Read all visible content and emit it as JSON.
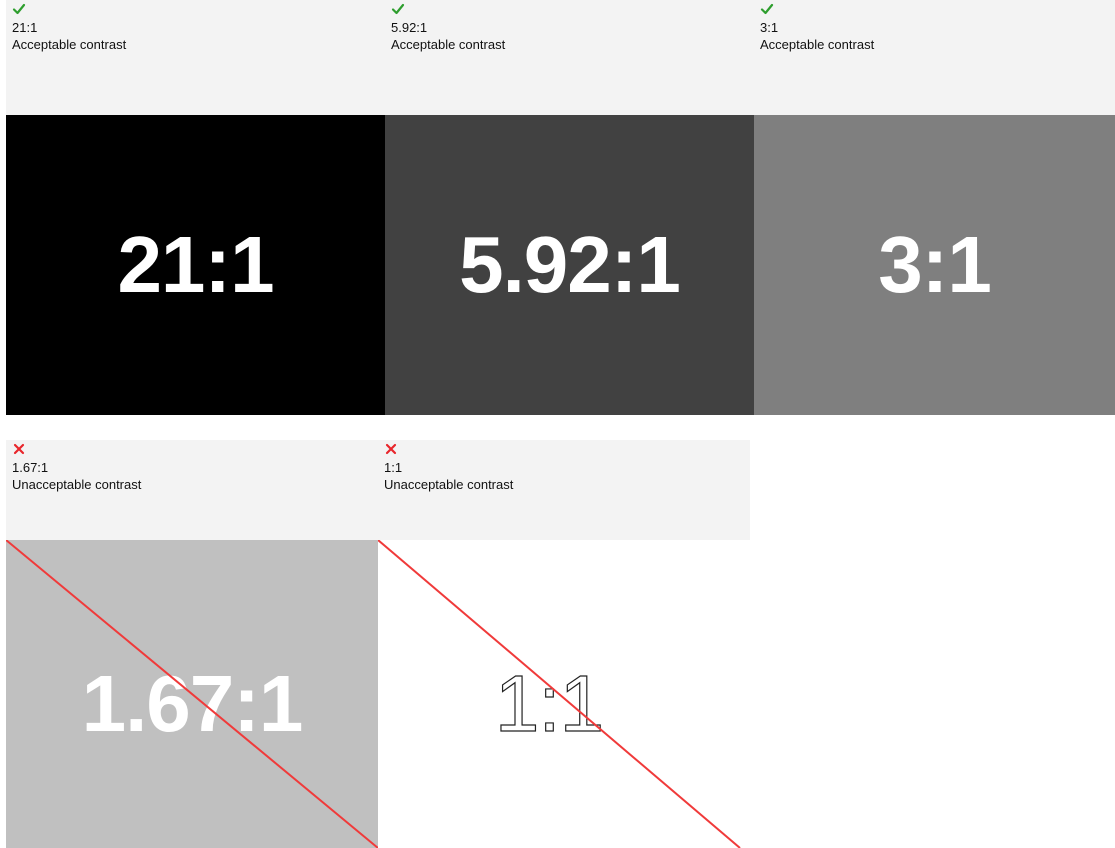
{
  "colors": {
    "header_bg": "#f3f3f3",
    "pass_icon": "#2e9e2e",
    "fail_icon": "#e8262b",
    "strike_line": "#f03a3a"
  },
  "cards": [
    {
      "status_icon": "checkmark-icon",
      "ratio": "21:1",
      "verdict": "Acceptable contrast",
      "sample_text": "21:1",
      "background": "#000000",
      "text_color": "#ffffff"
    },
    {
      "status_icon": "checkmark-icon",
      "ratio": "5.92:1",
      "verdict": "Acceptable contrast",
      "sample_text": "5.92:1",
      "background": "#414141",
      "text_color": "#ffffff"
    },
    {
      "status_icon": "checkmark-icon",
      "ratio": "3:1",
      "verdict": "Acceptable contrast",
      "sample_text": "3:1",
      "background": "#7f7f7f",
      "text_color": "#ffffff"
    },
    {
      "status_icon": "cross-icon",
      "ratio": "1.67:1",
      "verdict": "Unacceptable contrast",
      "sample_text": "1.67:1",
      "background": "#c0c0c0",
      "text_color": "#ffffff"
    },
    {
      "status_icon": "cross-icon",
      "ratio": "1:1",
      "verdict": "Unacceptable contrast",
      "sample_text": "1:1",
      "background": "#ffffff",
      "text_color": "#ffffff"
    }
  ]
}
